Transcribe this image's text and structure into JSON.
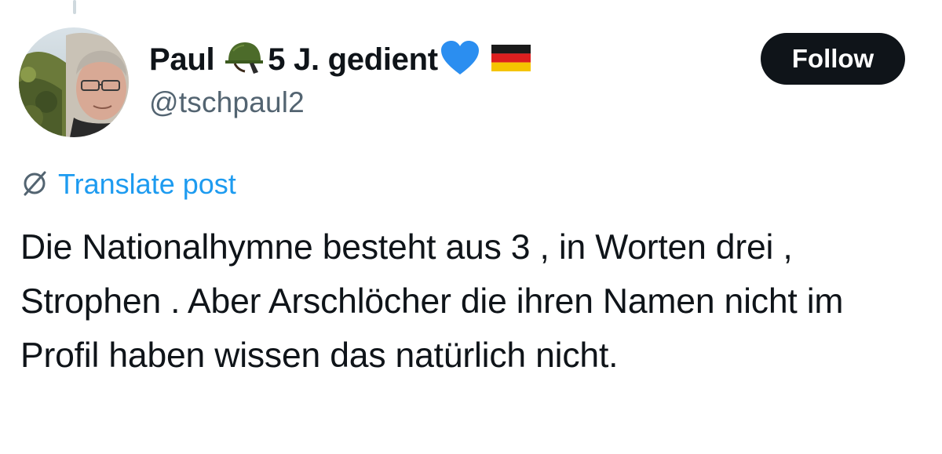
{
  "author": {
    "name": "Paul",
    "name_suffix": "5 J. gedient",
    "handle": "@tschpaul2",
    "emojis": [
      "helmet-icon",
      "blue-heart-icon",
      "germany-flag-icon"
    ]
  },
  "actions": {
    "follow_label": "Follow",
    "translate_label": "Translate post"
  },
  "post": {
    "text": "Die Nationalhymne besteht aus 3 , in Worten drei , Strophen . Aber Arschlöcher die ihren Namen nicht im Profil haben wissen das natürlich nicht."
  },
  "colors": {
    "text": "#0f1419",
    "secondary": "#536471",
    "link": "#1d9bf0",
    "button_bg": "#0f1419",
    "thread_line": "#cfd9de"
  }
}
